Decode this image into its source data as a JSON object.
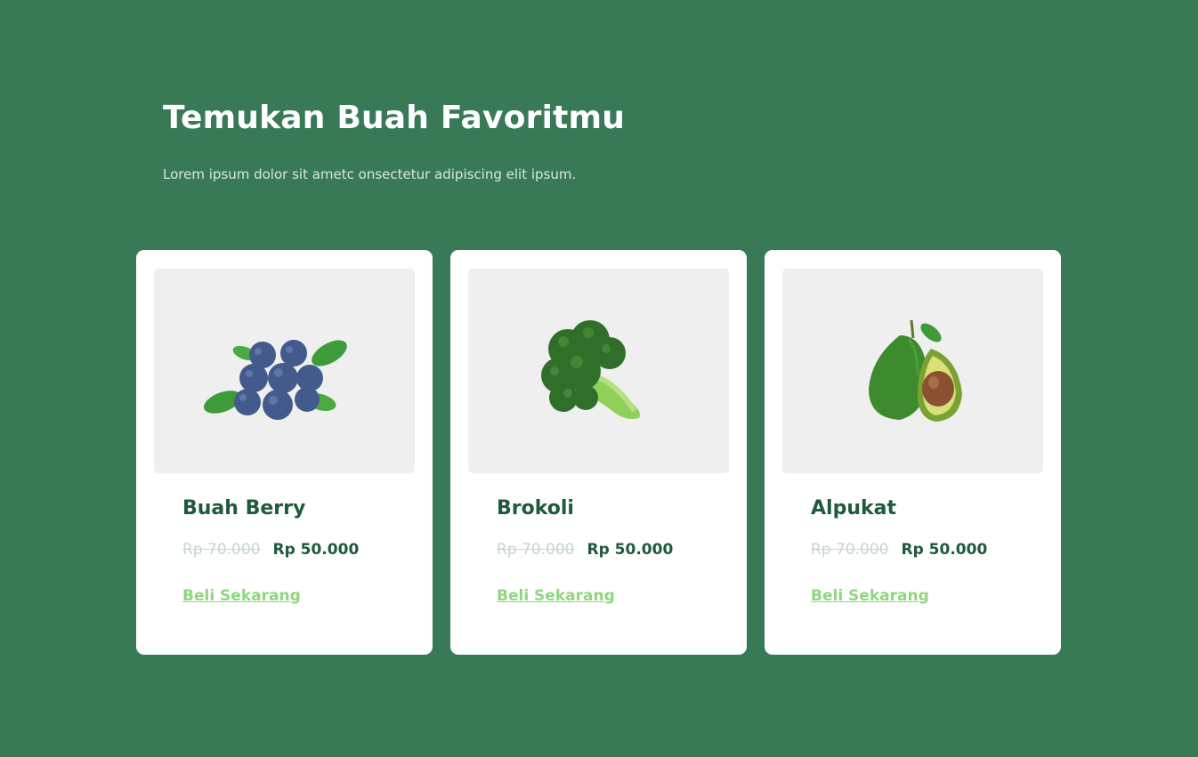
{
  "hero": {
    "title": "Temukan Buah Favoritmu",
    "subtitle": "Lorem ipsum dolor sit ametc onsectetur adipiscing elit ipsum."
  },
  "products": [
    {
      "name": "Buah Berry",
      "old_price": "Rp 70.000",
      "new_price": "Rp 50.000",
      "cta": "Beli Sekarang",
      "image": "blueberries-image"
    },
    {
      "name": "Brokoli",
      "old_price": "Rp 70.000",
      "new_price": "Rp 50.000",
      "cta": "Beli Sekarang",
      "image": "broccoli-image"
    },
    {
      "name": "Alpukat",
      "old_price": "Rp 70.000",
      "new_price": "Rp 50.000",
      "cta": "Beli Sekarang",
      "image": "avocado-image"
    }
  ],
  "colors": {
    "background": "#387a56",
    "card": "#ffffff",
    "image_box": "#efefef",
    "title": "#1e5a3c",
    "old_price": "#c5d6cc",
    "cta": "#8fd67f"
  }
}
